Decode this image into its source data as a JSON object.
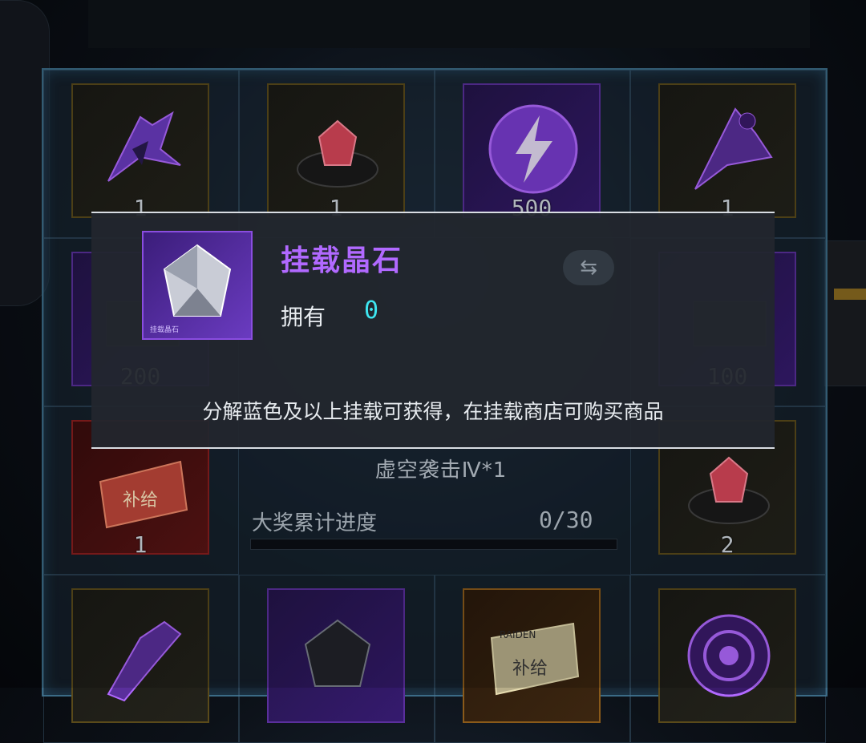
{
  "colors": {
    "accent_purple": "#b169ff",
    "owned_cyan": "#3ee6f0",
    "panel_border": "#3b6b86"
  },
  "grid": {
    "row1": [
      {
        "count": "1",
        "rarity": "gold",
        "icon": "purple-ship-icon"
      },
      {
        "count": "1",
        "rarity": "gold",
        "icon": "red-crystal-icon"
      },
      {
        "count": "500",
        "rarity": "purple",
        "icon": "lightning-orb-icon"
      },
      {
        "count": "1",
        "rarity": "gold",
        "icon": "purple-fighter-icon"
      }
    ],
    "row2": [
      {
        "count": "200",
        "rarity": "purple",
        "icon": "card-icon"
      },
      {
        "count": "100",
        "rarity": "purple",
        "icon": "card-icon"
      }
    ],
    "row3": [
      {
        "count": "1",
        "rarity": "red",
        "icon": "supply-ticket-icon",
        "label": "补给"
      },
      {
        "count": "2",
        "rarity": "gold",
        "icon": "red-crystal-icon"
      }
    ],
    "row4": [
      {
        "rarity": "gold",
        "icon": "purple-cannon-icon"
      },
      {
        "rarity": "purple",
        "icon": "dark-crystal-icon"
      },
      {
        "rarity": "orange",
        "icon": "raiden-supply-icon",
        "label": "补给",
        "brand": "RAIDEN"
      },
      {
        "rarity": "gold",
        "icon": "purple-disc-icon"
      }
    ]
  },
  "center": {
    "reward_title": "虚空袭击Ⅳ*1",
    "progress_label": "大奖累计进度",
    "progress_value": "0/30",
    "progress_fraction": 0
  },
  "popup": {
    "title": "挂载晶石",
    "owned_label": "拥有",
    "owned_value": "0",
    "description": "分解蓝色及以上挂载可获得，在挂载商店可购买商品",
    "icon": "mount-crystal-icon",
    "icon_caption": "挂载晶石"
  },
  "swap_icon": "⇆"
}
